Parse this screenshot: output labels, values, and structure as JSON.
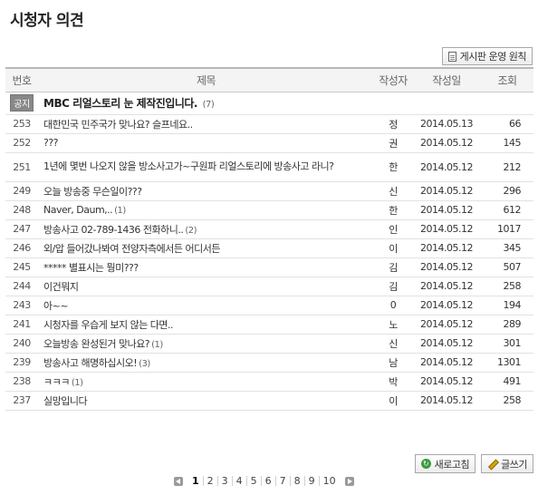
{
  "title": "시청자 의견",
  "rules_button": "게시판 운영 원칙",
  "columns": {
    "num": "번호",
    "subject": "제목",
    "writer": "작성자",
    "date": "작성일",
    "views": "조회"
  },
  "notice": {
    "badge": "공지",
    "subject": "MBC 리얼스토리 눈 제작진입니다.",
    "comments": "(7)"
  },
  "rows": [
    {
      "num": "253",
      "subject": "대한민국 민주국가 맞나요? 슬프네요..",
      "comments": "",
      "writer": "정",
      "date": "2014.05.13",
      "views": "66"
    },
    {
      "num": "252",
      "subject": "???",
      "comments": "",
      "writer": "권",
      "date": "2014.05.12",
      "views": "145"
    },
    {
      "num": "251",
      "subject": "1년에 몇번 나오지 않을 방소사고가~구원파 리얼스토리에 방송사고 라니?",
      "comments": "",
      "writer": "한",
      "date": "2014.05.12",
      "views": "212"
    },
    {
      "num": "249",
      "subject": "오늘 방송중 무슨일이???",
      "comments": "",
      "writer": "신",
      "date": "2014.05.12",
      "views": "296"
    },
    {
      "num": "248",
      "subject": "Naver, Daum,..",
      "comments": "(1)",
      "writer": "한",
      "date": "2014.05.12",
      "views": "612"
    },
    {
      "num": "247",
      "subject": "방송사고 02-789-1436 전화하니..",
      "comments": "(2)",
      "writer": "인",
      "date": "2014.05.12",
      "views": "1017"
    },
    {
      "num": "246",
      "subject": "외/압 들어갔나봐여 전양자측에서든 어디서든",
      "comments": "",
      "writer": "이",
      "date": "2014.05.12",
      "views": "345"
    },
    {
      "num": "245",
      "subject": "***** 별표시는 뭥미???",
      "comments": "",
      "writer": "김",
      "date": "2014.05.12",
      "views": "507"
    },
    {
      "num": "244",
      "subject": "이건뭐지",
      "comments": "",
      "writer": "김",
      "date": "2014.05.12",
      "views": "258"
    },
    {
      "num": "243",
      "subject": "아~~",
      "comments": "",
      "writer": "0",
      "date": "2014.05.12",
      "views": "194"
    },
    {
      "num": "241",
      "subject": "시청자를 우습게 보지 않는 다면..",
      "comments": "",
      "writer": "노",
      "date": "2014.05.12",
      "views": "289"
    },
    {
      "num": "240",
      "subject": "오늘방송 완성된거 맞나요?",
      "comments": "(1)",
      "writer": "신",
      "date": "2014.05.12",
      "views": "301"
    },
    {
      "num": "239",
      "subject": "방송사고 해명하십시오!",
      "comments": "(3)",
      "writer": "남",
      "date": "2014.05.12",
      "views": "1301"
    },
    {
      "num": "238",
      "subject": "ㅋㅋㅋ",
      "comments": "(1)",
      "writer": "박",
      "date": "2014.05.12",
      "views": "491"
    },
    {
      "num": "237",
      "subject": "실망입니다",
      "comments": "",
      "writer": "이",
      "date": "2014.05.12",
      "views": "258"
    }
  ],
  "buttons": {
    "refresh": "새로고침",
    "write": "글쓰기"
  },
  "pagination": [
    "1",
    "2",
    "3",
    "4",
    "5",
    "6",
    "7",
    "8",
    "9",
    "10"
  ],
  "current_page": "1"
}
